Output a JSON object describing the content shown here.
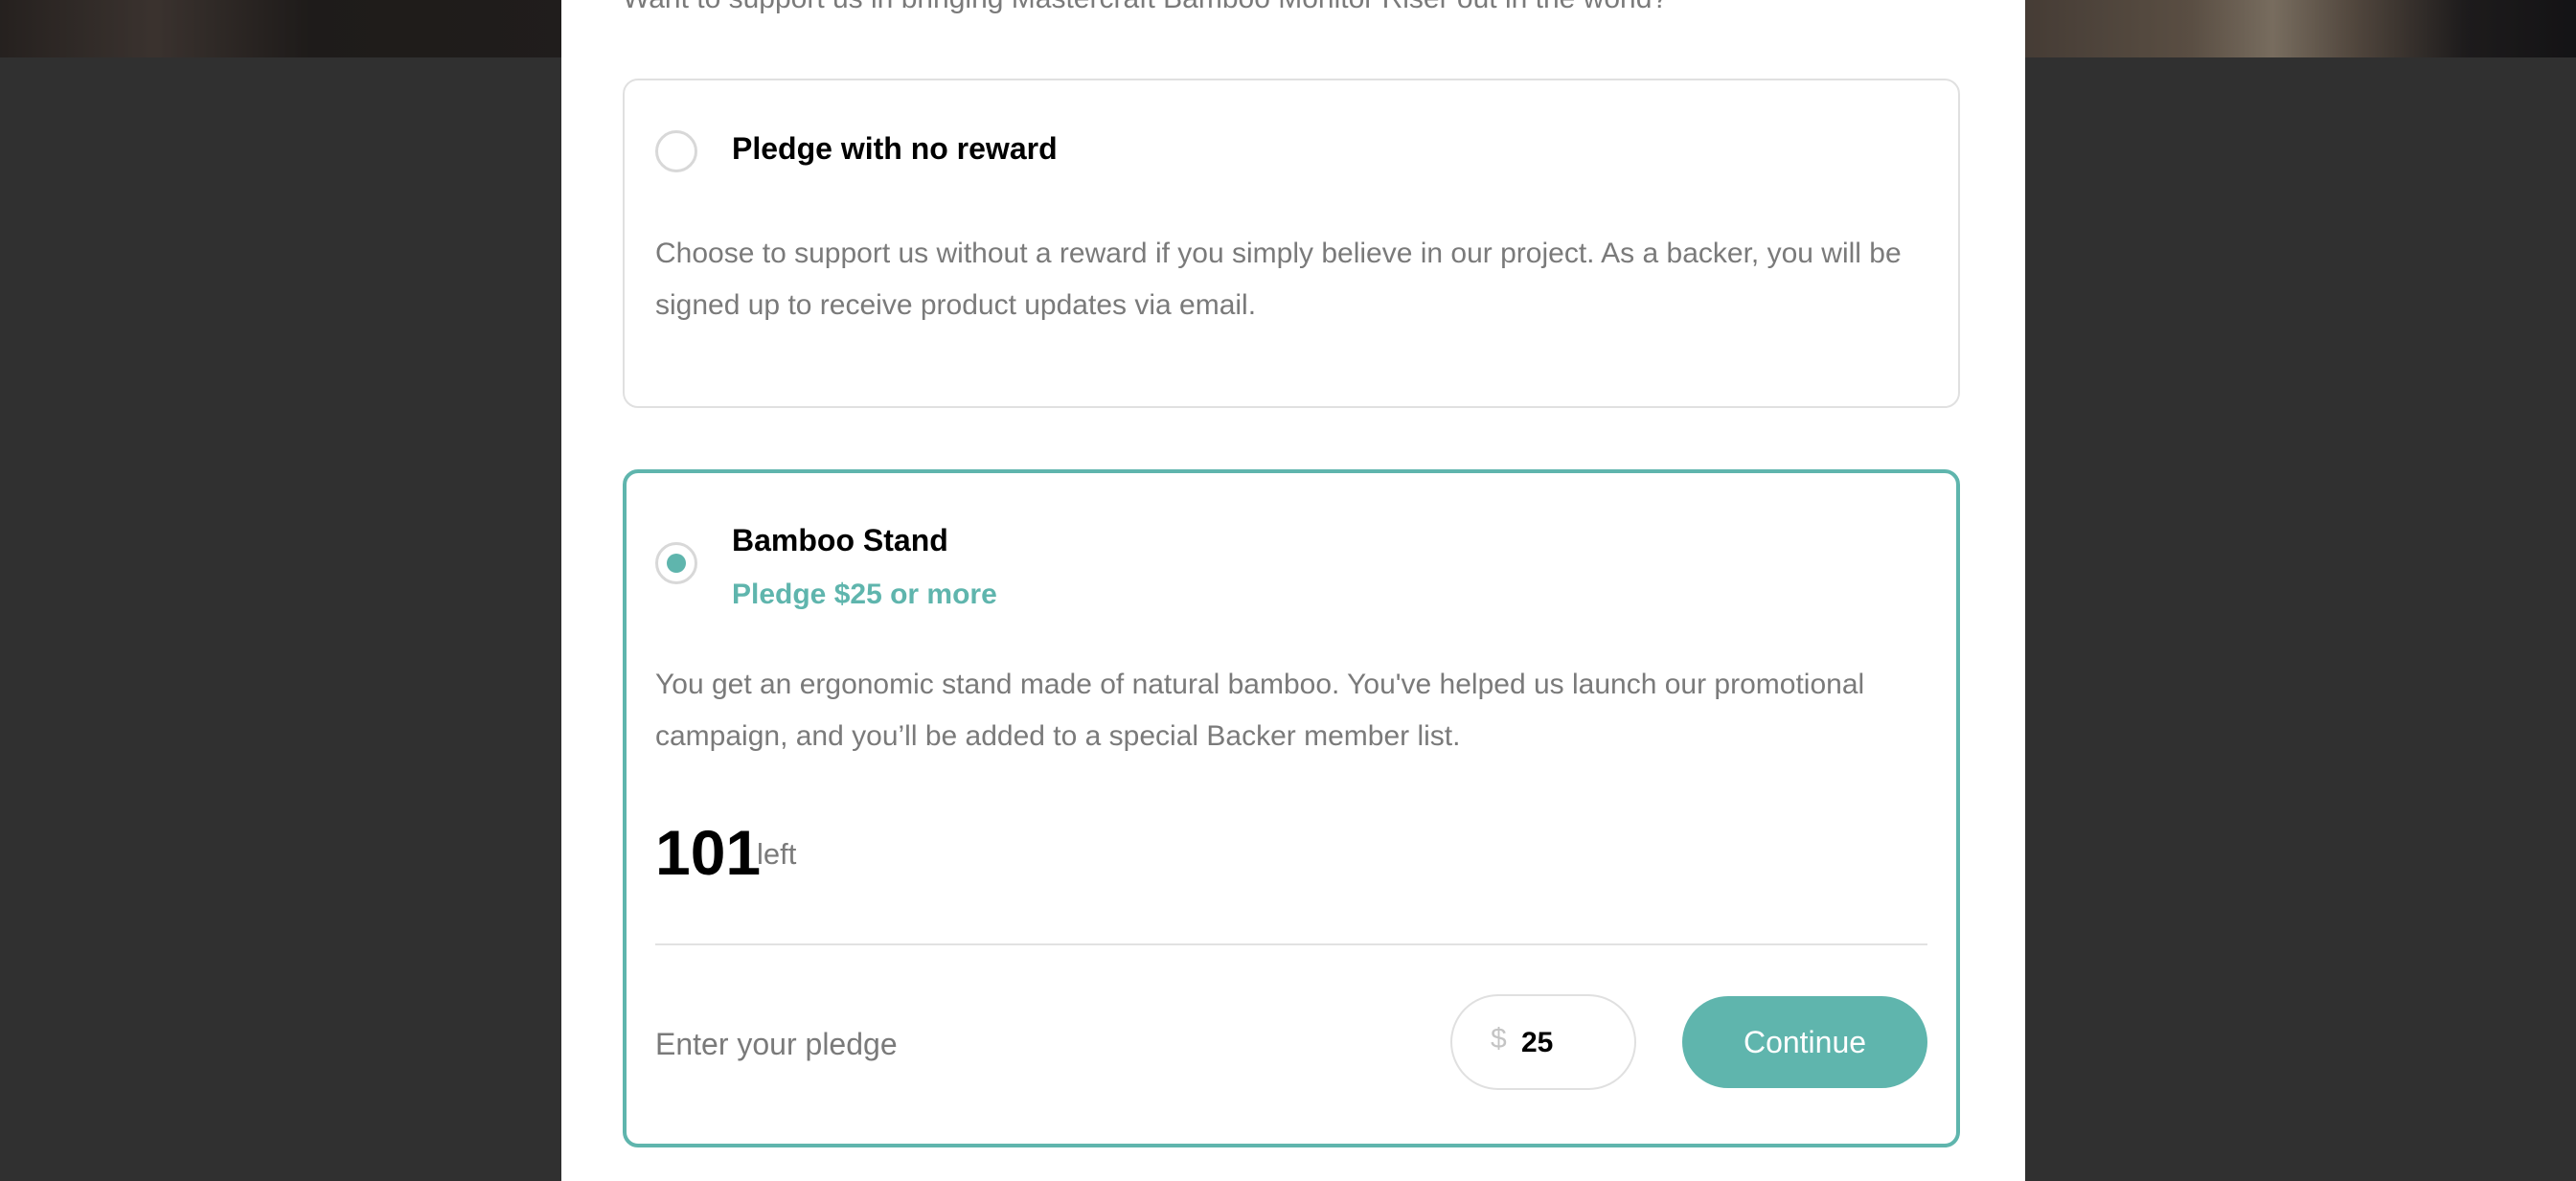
{
  "modal": {
    "intro_partial": "Want to support us in bringing Mastercraft Bamboo Monitor Riser out in the world?"
  },
  "options": [
    {
      "title": "Pledge with no reward",
      "description": "Choose to support us without a reward if you simply believe in our project. As a backer, you will be signed up to receive product updates via email.",
      "selected": false
    },
    {
      "title": "Bamboo Stand",
      "pledge_text": "Pledge $25 or more",
      "description": "You get an ergonomic stand made of natural bamboo. You've helped us launch our promotional campaign, and you’ll be added to a special Backer member list.",
      "left_count": "101",
      "left_label": "left",
      "selected": true,
      "pledge_prompt": "Enter your pledge",
      "currency_symbol": "$",
      "amount_value": "25",
      "continue_label": "Continue"
    }
  ],
  "colors": {
    "accent": "#5fb5ad",
    "overlay": "#4a4a4a",
    "text_muted": "#7a7a7a"
  },
  "icons": {
    "radio_unselected": "radio-empty-icon",
    "radio_selected": "radio-checked-icon"
  }
}
